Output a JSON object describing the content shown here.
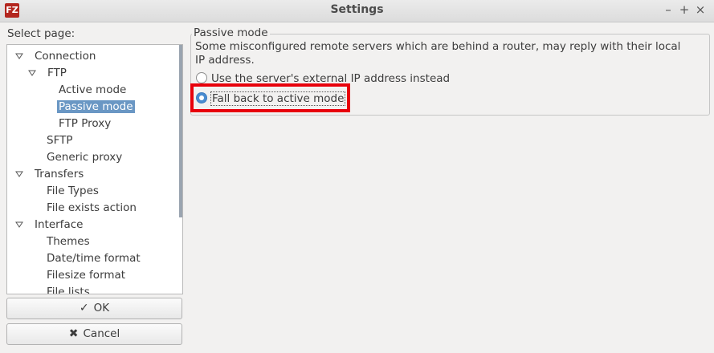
{
  "window": {
    "title": "Settings",
    "app_icon_text": "FZ",
    "minimize": "–",
    "maximize": "+",
    "close": "×"
  },
  "sidebar": {
    "label": "Select page:",
    "tree": [
      {
        "label": "Connection",
        "depth": 0,
        "expanded": true
      },
      {
        "label": "FTP",
        "depth": 1,
        "expanded": true
      },
      {
        "label": "Active mode",
        "depth": 2
      },
      {
        "label": "Passive mode",
        "depth": 2,
        "selected": true
      },
      {
        "label": "FTP Proxy",
        "depth": 2
      },
      {
        "label": "SFTP",
        "depth": 1
      },
      {
        "label": "Generic proxy",
        "depth": 1
      },
      {
        "label": "Transfers",
        "depth": 0,
        "expanded": true
      },
      {
        "label": "File Types",
        "depth": 1
      },
      {
        "label": "File exists action",
        "depth": 1
      },
      {
        "label": "Interface",
        "depth": 0,
        "expanded": true
      },
      {
        "label": "Themes",
        "depth": 1
      },
      {
        "label": "Date/time format",
        "depth": 1
      },
      {
        "label": "Filesize format",
        "depth": 1
      },
      {
        "label": "File lists",
        "depth": 1
      }
    ]
  },
  "buttons": {
    "ok_label": "OK",
    "ok_icon": "✓",
    "cancel_label": "Cancel",
    "cancel_icon": "✖"
  },
  "passive_mode": {
    "title": "Passive mode",
    "description": "Some misconfigured remote servers which are behind a router, may reply with their local IP address.",
    "options": [
      {
        "label": "Use the server's external IP address instead",
        "checked": false
      },
      {
        "label": "Fall back to active mode",
        "checked": true
      }
    ]
  },
  "colors": {
    "selection": "#6a97c4",
    "highlight_box": "#e8000b",
    "radio_checked": "#4a8cd0"
  }
}
